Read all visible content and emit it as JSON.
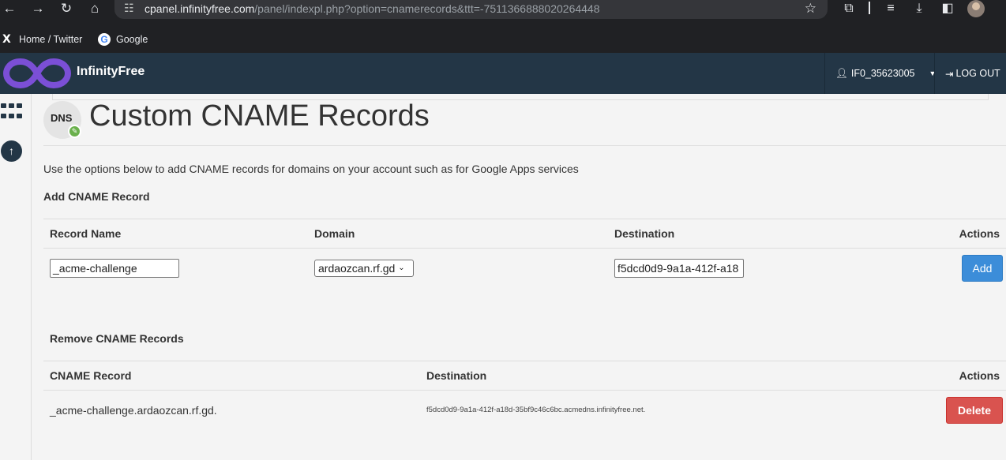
{
  "browser": {
    "url_host": "cpanel.infinityfree.com",
    "url_path": "/panel/indexpl.php?option=cnamerecords&ttt=-7511366888020264448",
    "bookmarks": [
      {
        "label": "Home / Twitter",
        "icon": "x-logo-icon"
      },
      {
        "label": "Google",
        "icon": "google-logo-icon"
      }
    ]
  },
  "header": {
    "brand": "InfinityFree",
    "username": "IF0_35623005",
    "logout_label": "LOG OUT"
  },
  "page": {
    "icon_text": "DNS",
    "title": "Custom CNAME Records",
    "intro": "Use the options below to add CNAME records for domains on your account such as for Google Apps services"
  },
  "add_section": {
    "heading": "Add CNAME Record",
    "columns": {
      "record_name": "Record Name",
      "domain": "Domain",
      "destination": "Destination",
      "actions": "Actions"
    },
    "record_name_value": "_acme-challenge",
    "domain_value": "ardaozcan.rf.gd",
    "destination_value": "f5dcd0d9-9a1a-412f-a18",
    "add_label": "Add"
  },
  "remove_section": {
    "heading": "Remove CNAME Records",
    "columns": {
      "cname": "CNAME Record",
      "destination": "Destination",
      "actions": "Actions"
    },
    "rows": [
      {
        "cname": "_acme-challenge.ardaozcan.rf.gd.",
        "destination": "f5dcd0d9-9a1a-412f-a18d-35bf9c46c6bc.acmedns.infinityfree.net.",
        "delete_label": "Delete"
      }
    ]
  },
  "colors": {
    "header_bg": "#233646",
    "add_button": "#3c8dd9",
    "delete_button": "#d9534f",
    "logo_purple": "#7b4fd6"
  }
}
